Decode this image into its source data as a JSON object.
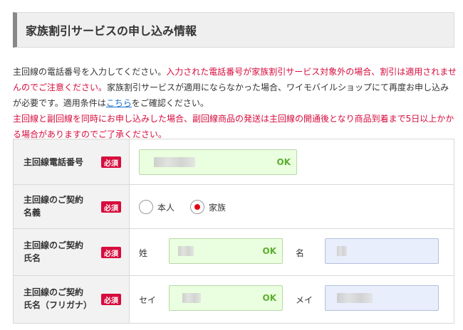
{
  "section_title": "家族割引サービスの申し込み情報",
  "notice": {
    "p1_normal": "主回線の電話番号を入力してください。",
    "p1_red": "入力された電話番号が家族割引サービス対象外の場合、割引は適用されませんのでご注意ください。",
    "p2_normal": "家族割引サービスが適用にならなかった場合、ワイモバイルショップにて再度お申し込みが必要です。適用条件は",
    "p2_link": "こちら",
    "p2_end": "をご確認ください。",
    "p3_red": "主回線と副回線を同時にお申し込みした場合、副回線商品の発送は主回線の開通後となり商品到着まで5日以上かかる場合がありますのでご了承ください。"
  },
  "required_label": "必須",
  "ok_label": "OK",
  "rows": {
    "phone": {
      "label": "主回線電話番号"
    },
    "contract_name": {
      "label_line1": "主回線のご契約",
      "label_line2": "名義",
      "options": [
        {
          "label": "本人",
          "selected": false
        },
        {
          "label": "家族",
          "selected": true
        }
      ]
    },
    "full_name": {
      "label_line1": "主回線のご契約",
      "label_line2": "氏名",
      "last_label": "姓",
      "first_label": "名"
    },
    "full_name_kana": {
      "label_line1": "主回線のご契約",
      "label_line2": "氏名（フリガナ）",
      "last_label": "セイ",
      "first_label": "メイ"
    }
  },
  "colors": {
    "accent_red": "#d70c3d",
    "ok_green": "#5cae2f",
    "valid_bg": "#eaffdf",
    "pending_bg": "#e8eefc"
  }
}
